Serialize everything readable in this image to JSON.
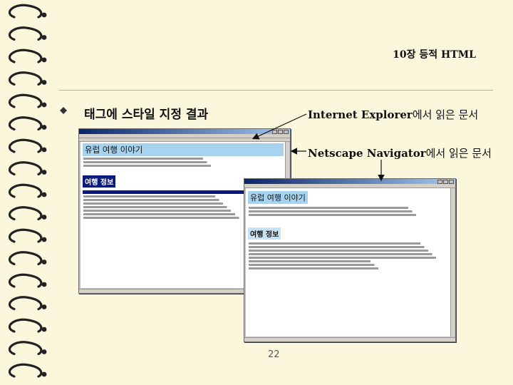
{
  "header": {
    "text": "10장 등적 HTML"
  },
  "slide": {
    "title": "태그에 스타일 지정 결과",
    "page_number": "22"
  },
  "labels": {
    "ie_name": "Internet Explorer",
    "ie_suffix": "에서 읽은 문서",
    "ns_name": "Netscape Navigator",
    "ns_suffix": "에서 읽은 문서"
  },
  "ie_window": {
    "heading": "유럽 여행 이야기",
    "section": "여행 정보"
  },
  "ns_window": {
    "heading": "유럽 여행 이야기",
    "section": "여행 정보"
  },
  "colors": {
    "background": "#fbf7dc",
    "heading_bg": "#a7d3ee",
    "section_bg": "#0a1a7a"
  }
}
